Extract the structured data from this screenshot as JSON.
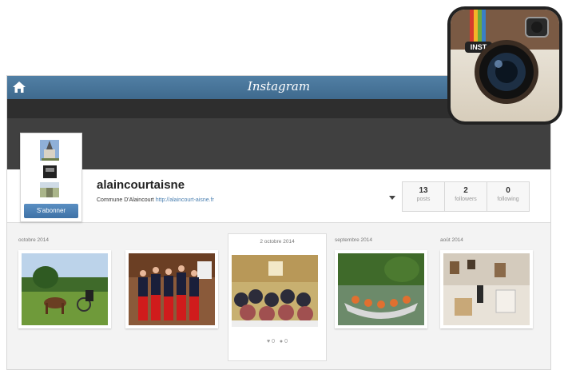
{
  "header": {
    "brand": "Instagram",
    "home_icon": "home-icon"
  },
  "profile": {
    "username": "alaincourtaisne",
    "bio_name": "Commune D'Alaincourt",
    "bio_link": "http://alaincourt-aisne.fr",
    "follow_label": "S'abonner",
    "stats": [
      {
        "num": "13",
        "label": "posts"
      },
      {
        "num": "2",
        "label": "followers"
      },
      {
        "num": "0",
        "label": "following"
      }
    ]
  },
  "grid": {
    "columns": [
      {
        "month": "octobre 2014"
      },
      {
        "month": ""
      },
      {
        "month": "2 octobre 2014",
        "likes": "0",
        "comments": "0"
      },
      {
        "month": "septembre 2014"
      },
      {
        "month": "août 2014"
      }
    ]
  },
  "colors": {
    "topbar": "#517fa4",
    "button": "#3e71a6",
    "link": "#4a7fb0",
    "dark": "#2e2e2e"
  }
}
